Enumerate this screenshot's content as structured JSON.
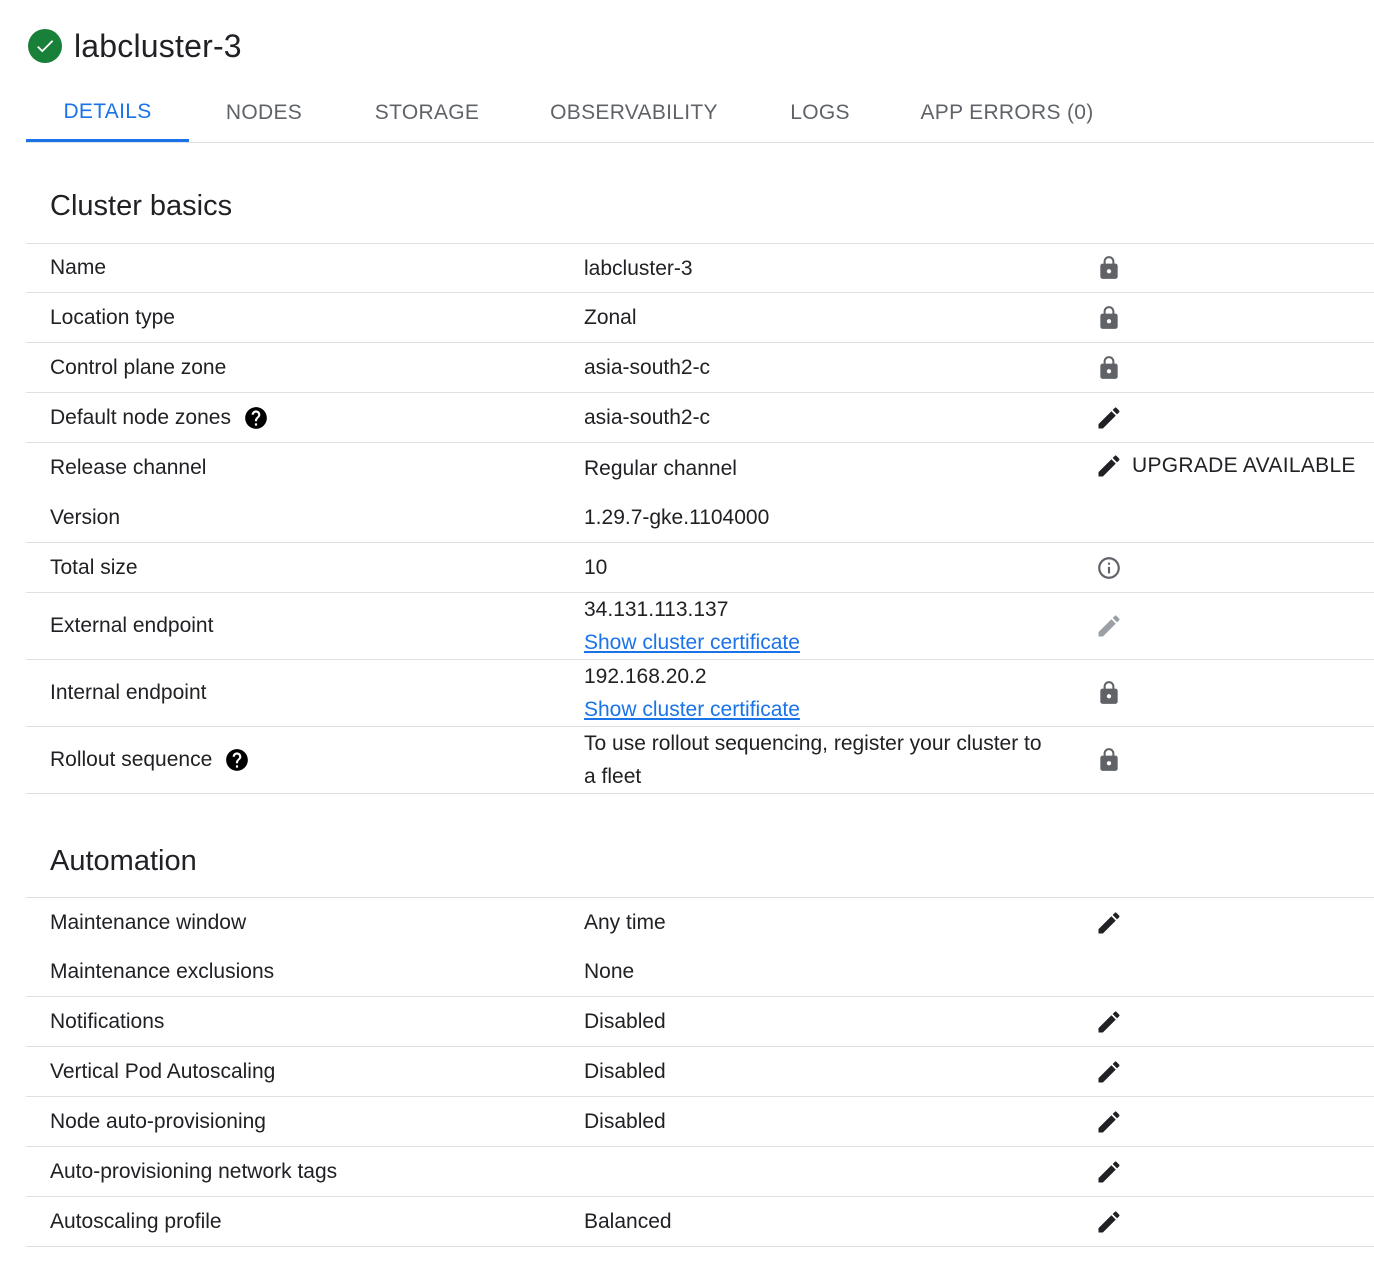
{
  "header": {
    "title": "labcluster-3",
    "status_icon": "check-circle-icon"
  },
  "tabs": [
    {
      "label": "DETAILS",
      "active": true
    },
    {
      "label": "NODES"
    },
    {
      "label": "STORAGE"
    },
    {
      "label": "OBSERVABILITY"
    },
    {
      "label": "LOGS"
    },
    {
      "label": "APP ERRORS (0)"
    }
  ],
  "cluster_basics": {
    "title": "Cluster basics",
    "rows": [
      {
        "label": "Name",
        "value": "labcluster-3",
        "icon": "lock-icon"
      },
      {
        "label": "Location type",
        "value": "Zonal",
        "icon": "lock-icon"
      },
      {
        "label": "Control plane zone",
        "value": "asia-south2-c",
        "icon": "lock-icon"
      },
      {
        "label": "Default node zones",
        "value": "asia-south2-c",
        "icon": "edit-icon",
        "help": "help-icon"
      },
      {
        "label": "Release channel",
        "value": "Regular channel",
        "icon": "edit-icon",
        "action_label": "UPGRADE AVAILABLE"
      },
      {
        "label": "Version",
        "value": "1.29.7-gke.1104000"
      },
      {
        "label": "Total size",
        "value": "10",
        "icon": "info-icon"
      },
      {
        "label": "External endpoint",
        "value": "34.131.113.137",
        "link": "Show cluster certificate",
        "icon": "edit-icon-disabled"
      },
      {
        "label": "Internal endpoint",
        "value": "192.168.20.2",
        "link": "Show cluster certificate",
        "icon": "lock-icon"
      },
      {
        "label": "Rollout sequence",
        "value_line1": "To use rollout sequencing, register your cluster to",
        "value_line2": "a fleet",
        "icon": "lock-icon",
        "help": "help-icon"
      }
    ]
  },
  "automation": {
    "title": "Automation",
    "rows": [
      {
        "label": "Maintenance window",
        "value": "Any time",
        "icon": "edit-icon"
      },
      {
        "label": "Maintenance exclusions",
        "value": "None"
      },
      {
        "label": "Notifications",
        "value": "Disabled",
        "icon": "edit-icon"
      },
      {
        "label": "Vertical Pod Autoscaling",
        "value": "Disabled",
        "icon": "edit-icon"
      },
      {
        "label": "Node auto-provisioning",
        "value": "Disabled",
        "icon": "edit-icon"
      },
      {
        "label": "Auto-provisioning network tags",
        "value": "",
        "icon": "edit-icon"
      },
      {
        "label": "Autoscaling profile",
        "value": "Balanced",
        "icon": "edit-icon"
      }
    ]
  },
  "colors": {
    "accent": "#1a73e8",
    "success": "#188038",
    "text": "#202124",
    "muted": "#5f6368",
    "icon": "#5f6368",
    "divider": "#e0e0e0"
  }
}
